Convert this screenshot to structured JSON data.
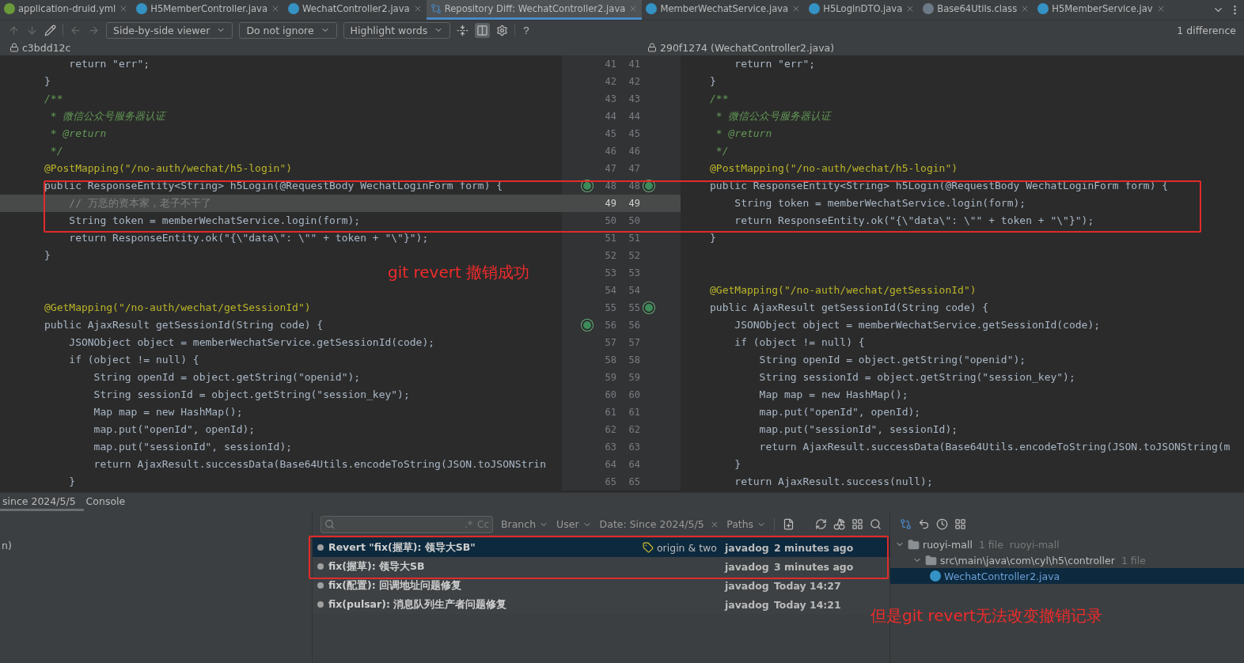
{
  "editor_tabs": [
    {
      "label": "application-druid.yml",
      "kind": "yml",
      "selected": false
    },
    {
      "label": "H5MemberController.java",
      "kind": "class",
      "selected": false
    },
    {
      "label": "WechatController2.java",
      "kind": "class",
      "selected": false
    },
    {
      "label": "Repository Diff: WechatController2.java",
      "kind": "diff",
      "selected": true
    },
    {
      "label": "MemberWechatService.java",
      "kind": "class",
      "selected": false
    },
    {
      "label": "H5LoginDTO.java",
      "kind": "class",
      "selected": false
    },
    {
      "label": "Base64Utils.class",
      "kind": "lib",
      "selected": false
    },
    {
      "label": "H5MemberService.jav",
      "kind": "class",
      "selected": false
    }
  ],
  "toolbar": {
    "dropdowns": [
      "Side-by-side viewer",
      "Do not ignore",
      "Highlight words"
    ],
    "help": "?",
    "differences": "1 difference"
  },
  "left_header": "c3bdd12c",
  "right_header": "290f1274 (WechatController2.java)",
  "rows": [
    {
      "left_no": "41",
      "right_no": "41",
      "left": {
        "text": "    return \"err\";",
        "kind": "code"
      },
      "right": {
        "text": "    return \"err\";",
        "kind": "code"
      },
      "changed": false,
      "kind": "plain"
    },
    {
      "left_no": "42",
      "right_no": "42",
      "left": {
        "text": "}",
        "kind": "code"
      },
      "right": {
        "text": "}",
        "kind": "code"
      },
      "changed": false,
      "kind": "plain"
    },
    {
      "left_no": "43",
      "right_no": "43",
      "left": {
        "text": "/**",
        "kind": "doc"
      },
      "right": {
        "text": "/**",
        "kind": "doc"
      },
      "changed": false,
      "kind": "plain"
    },
    {
      "left_no": "44",
      "right_no": "44",
      "left": {
        "text": " * 微信公众号服务器认证",
        "kind": "doc"
      },
      "right": {
        "text": " * 微信公众号服务器认证",
        "kind": "doc"
      },
      "changed": false,
      "kind": "plain"
    },
    {
      "left_no": "45",
      "right_no": "45",
      "left": {
        "text": " * @return",
        "kind": "doc"
      },
      "right": {
        "text": " * @return",
        "kind": "doc"
      },
      "changed": false,
      "kind": "plain"
    },
    {
      "left_no": "46",
      "right_no": "46",
      "left": {
        "text": " */",
        "kind": "doc"
      },
      "right": {
        "text": " */",
        "kind": "doc"
      },
      "changed": false,
      "kind": "plain"
    },
    {
      "left_no": "47",
      "right_no": "47",
      "left": {
        "text": "@PostMapping(\"/no-auth/wechat/h5-login\")",
        "kind": "annotation"
      },
      "right": {
        "text": "@PostMapping(\"/no-auth/wechat/h5-login\")",
        "kind": "annotation"
      },
      "changed": false,
      "kind": "plain"
    },
    {
      "left_no": "48",
      "right_no": "48",
      "left": {
        "text": "public ResponseEntity<String> h5Login(@RequestBody WechatLoginForm form) {",
        "kind": "code"
      },
      "right": {
        "text": "public ResponseEntity<String> h5Login(@RequestBody WechatLoginForm form) {",
        "kind": "code"
      },
      "changed": false,
      "kind": "both"
    },
    {
      "left_no": "49",
      "right_no": "49",
      "left": {
        "text": "    // 万恶的资本家，老子不干了",
        "kind": "comment"
      },
      "right": {
        "text": "    String token = memberWechatService.login(form);",
        "kind": "code"
      },
      "changed": true,
      "kind": "plain"
    },
    {
      "left_no": "50",
      "right_no": "50",
      "left": {
        "text": "    String token = memberWechatService.login(form);",
        "kind": "code"
      },
      "right": {
        "text": "    return ResponseEntity.ok(\"{\\\"data\\\": \\\"\" + token + \"\\\"}\");",
        "kind": "code"
      },
      "changed": false,
      "kind": "plain"
    },
    {
      "left_no": "51",
      "right_no": "51",
      "left": {
        "text": "    return ResponseEntity.ok(\"{\\\"data\\\": \\\"\" + token + \"\\\"}\");",
        "kind": "code"
      },
      "right": {
        "text": "}",
        "kind": "code"
      },
      "changed": false,
      "kind": "plain"
    },
    {
      "left_no": "52",
      "right_no": "52",
      "left": {
        "text": "}",
        "kind": "code"
      },
      "changed": false,
      "kind": "plain"
    },
    {
      "left_no": "53",
      "right_no": "53",
      "changed": false,
      "kind": "plain"
    },
    {
      "left_no": "54",
      "right_no": "54",
      "right": {
        "text": "@GetMapping(\"/no-auth/wechat/getSessionId\")",
        "kind": "annotation"
      },
      "changed": false,
      "kind": "plain"
    },
    {
      "left_no": "55",
      "right_no": "55",
      "left": {
        "text": "@GetMapping(\"/no-auth/wechat/getSessionId\")",
        "kind": "annotation"
      },
      "right": {
        "text": "public AjaxResult getSessionId(String code) {",
        "kind": "code"
      },
      "changed": false,
      "kind": "right"
    },
    {
      "left_no": "56",
      "right_no": "56",
      "left": {
        "text": "public AjaxResult getSessionId(String code) {",
        "kind": "code"
      },
      "right": {
        "text": "    JSONObject object = memberWechatService.getSessionId(code);",
        "kind": "code"
      },
      "changed": false,
      "kind": "left"
    },
    {
      "left_no": "57",
      "right_no": "57",
      "left": {
        "text": "    JSONObject object = memberWechatService.getSessionId(code);",
        "kind": "code"
      },
      "right": {
        "text": "    if (object != null) {",
        "kind": "code"
      },
      "changed": false,
      "kind": "plain"
    },
    {
      "left_no": "58",
      "right_no": "58",
      "left": {
        "text": "    if (object != null) {",
        "kind": "code"
      },
      "right": {
        "text": "        String openId = object.getString(\"openid\");",
        "kind": "code"
      },
      "changed": false,
      "kind": "plain"
    },
    {
      "left_no": "59",
      "right_no": "59",
      "left": {
        "text": "        String openId = object.getString(\"openid\");",
        "kind": "code"
      },
      "right": {
        "text": "        String sessionId = object.getString(\"session_key\");",
        "kind": "code"
      },
      "changed": false,
      "kind": "plain"
    },
    {
      "left_no": "60",
      "right_no": "60",
      "left": {
        "text": "        String sessionId = object.getString(\"session_key\");",
        "kind": "code"
      },
      "right": {
        "text": "        Map map = new HashMap();",
        "kind": "code"
      },
      "changed": false,
      "kind": "plain"
    },
    {
      "left_no": "61",
      "right_no": "61",
      "left": {
        "text": "        Map map = new HashMap();",
        "kind": "code"
      },
      "right": {
        "text": "        map.put(\"openId\", openId);",
        "kind": "code"
      },
      "changed": false,
      "kind": "plain"
    },
    {
      "left_no": "62",
      "right_no": "62",
      "left": {
        "text": "        map.put(\"openId\", openId);",
        "kind": "code"
      },
      "right": {
        "text": "        map.put(\"sessionId\", sessionId);",
        "kind": "code"
      },
      "changed": false,
      "kind": "plain"
    },
    {
      "left_no": "63",
      "right_no": "63",
      "left": {
        "text": "        map.put(\"sessionId\", sessionId);",
        "kind": "code"
      },
      "right": {
        "text": "        return AjaxResult.successData(Base64Utils.encodeToString(JSON.toJSONString(m",
        "kind": "code"
      },
      "changed": false,
      "kind": "plain"
    },
    {
      "left_no": "64",
      "right_no": "64",
      "left": {
        "text": "        return AjaxResult.successData(Base64Utils.encodeToString(JSON.toJSONStrin",
        "kind": "code"
      },
      "right": {
        "text": "    }",
        "kind": "code"
      },
      "changed": false,
      "kind": "plain"
    },
    {
      "left_no": "65",
      "right_no": "65",
      "left": {
        "text": "    }",
        "kind": "code"
      },
      "right": {
        "text": "    return AjaxResult.success(null);",
        "kind": "code"
      },
      "changed": false,
      "kind": "plain"
    }
  ],
  "annotations": [
    "git revert 撤销成功",
    "但是git revert无法改变撤销记录"
  ],
  "bottom_tabs": [
    {
      "label": "since 2024/5/5",
      "selected": true
    },
    {
      "label": "Console",
      "selected": false
    }
  ],
  "side_fragment": "n)",
  "log_filters": {
    "search_regex": ".*",
    "search_case": "Cc",
    "branch": "Branch",
    "user": "User",
    "date": "Date: Since 2024/5/5",
    "clear": "×",
    "paths": "Paths"
  },
  "commits": [
    {
      "message": "Revert \"fix(握草): 领导大SB\"",
      "tag": "origin & two",
      "author": "javadog",
      "date": "2 minutes ago",
      "selected": true
    },
    {
      "message": "fix(握草): 领导大SB",
      "author": "javadog",
      "date": "3 minutes ago",
      "selected": false
    },
    {
      "message": "fix(配置): 回调地址问题修复",
      "author": "javadog",
      "date": "Today 14:27",
      "selected": false
    },
    {
      "message": "fix(pulsar): 消息队列生产者问题修复",
      "author": "javadog",
      "date": "Today 14:21",
      "selected": false
    }
  ],
  "changes_tree": [
    {
      "name": "ruoyi-mall",
      "count": "1 file",
      "module": "ruoyi-mall",
      "children": [
        {
          "name": "src\\main\\java\\com\\cyl\\h5\\controller",
          "count": "1 file",
          "children": [
            {
              "name": "WechatController2.java",
              "selected": true
            }
          ]
        }
      ]
    }
  ]
}
